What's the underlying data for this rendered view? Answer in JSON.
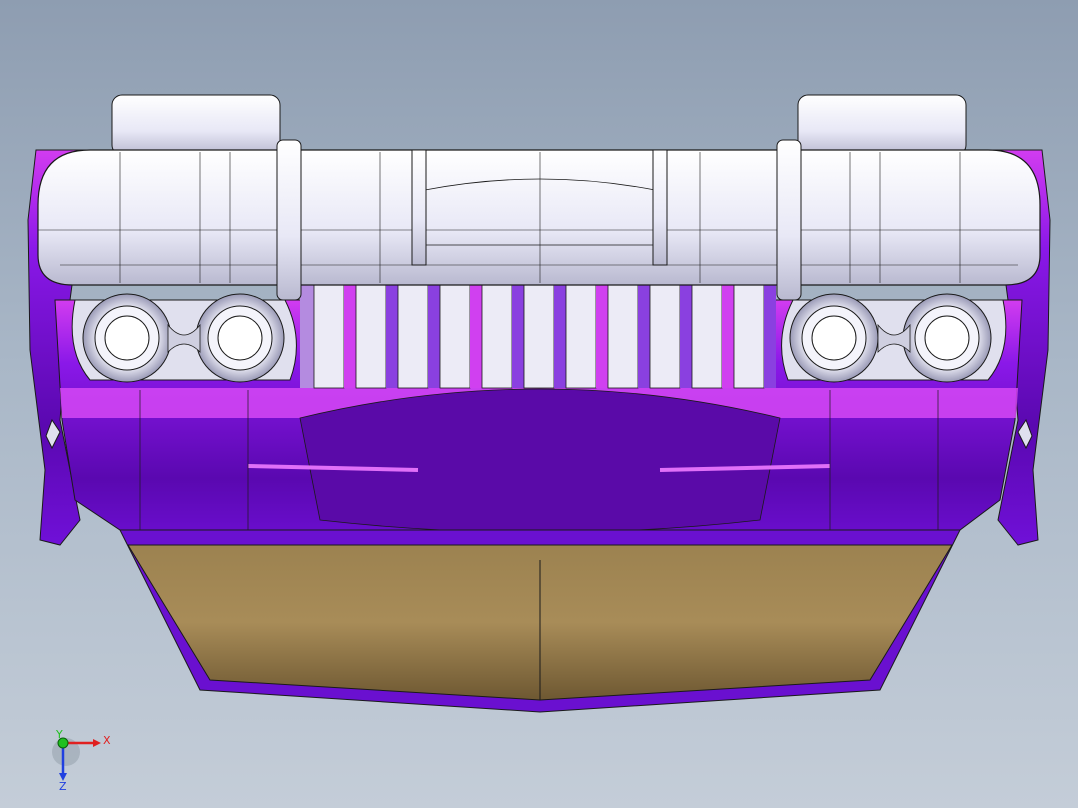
{
  "viewport": {
    "triad": {
      "x_label": "X",
      "y_label": "Y",
      "z_label": "Z",
      "x_color": "#e02020",
      "y_color": "#20c020",
      "z_color": "#2040e0"
    }
  },
  "model": {
    "colors": {
      "upper_body": "#f0f0fa",
      "upper_shadow": "#b8b8cc",
      "body_purple": "#7c10e0",
      "body_magenta": "#e040f0",
      "body_dark": "#4a0690",
      "tan_panel": "#a8895a",
      "tan_dark": "#7a6238",
      "edge": "#1a1a1a"
    }
  }
}
